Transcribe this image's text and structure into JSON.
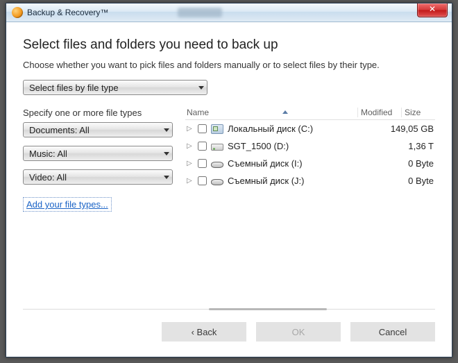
{
  "window": {
    "title": "Backup & Recovery™"
  },
  "heading": "Select files and folders you need to back up",
  "subheading": "Choose whether you want to pick files and folders manually or to select files by their type.",
  "mode_combo": "Select files by file type",
  "specify_label": "Specify one or more file types",
  "type_combos": {
    "documents": "Documents: All",
    "music": "Music: All",
    "video": "Video: All"
  },
  "add_types_link": "Add your file types...",
  "columns": {
    "name": "Name",
    "modified": "Modified",
    "size": "Size"
  },
  "drives": [
    {
      "icon": "c",
      "label": "Локальный диск (C:)",
      "size": "149,05 GB"
    },
    {
      "icon": "hdd",
      "label": "SGT_1500 (D:)",
      "size": "1,36 T"
    },
    {
      "icon": "rem",
      "label": "Съемный диск (I:)",
      "size": "0 Byte"
    },
    {
      "icon": "rem",
      "label": "Съемный диск (J:)",
      "size": "0 Byte"
    }
  ],
  "buttons": {
    "back": "‹ Back",
    "ok": "OK",
    "cancel": "Cancel"
  }
}
